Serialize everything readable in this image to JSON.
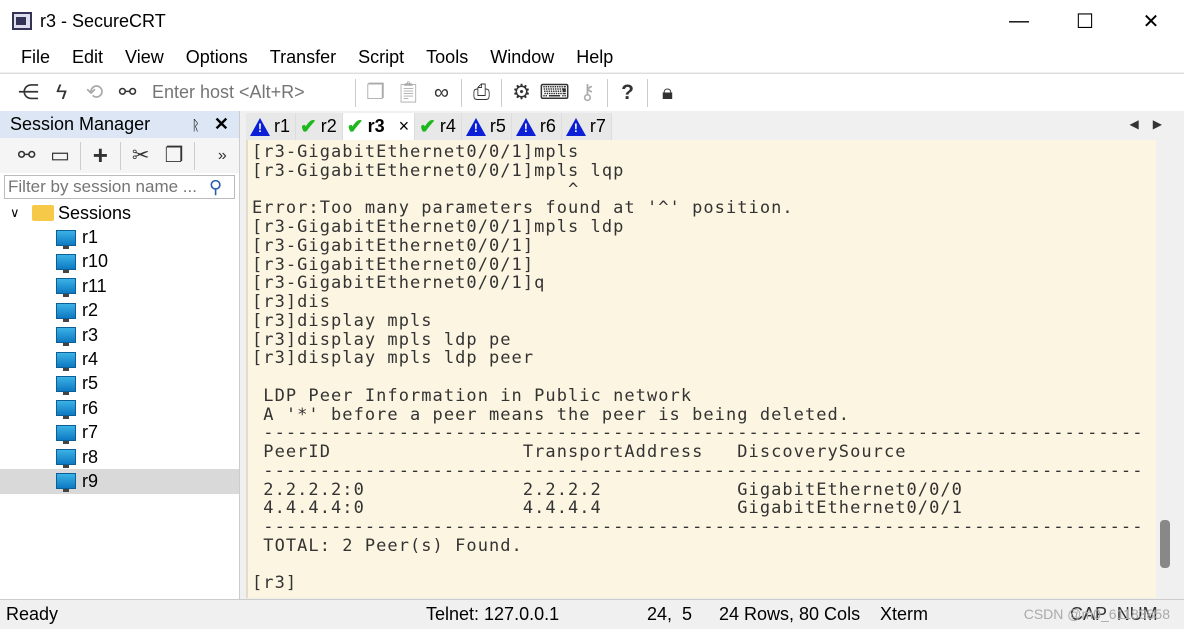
{
  "window": {
    "title": "r3 - SecureCRT",
    "minimize": "—",
    "maximize": "☐",
    "close": "✕"
  },
  "menu": [
    "File",
    "Edit",
    "View",
    "Options",
    "Transfer",
    "Script",
    "Tools",
    "Window",
    "Help"
  ],
  "toolbar": {
    "host_placeholder": "Enter host <Alt+R>",
    "icons": [
      "connect-tree",
      "lightning",
      "reconnect",
      "link",
      "copy",
      "paste",
      "find-binoculars",
      "print",
      "settings-gear",
      "keymap-keyboard",
      "key",
      "help",
      "sftp-lock"
    ]
  },
  "session_manager": {
    "title": "Session Manager",
    "pin": "ᚱ",
    "close": "✕",
    "more": "»",
    "filter_placeholder": "Filter by session name ...",
    "root": "Sessions",
    "sessions": [
      "r1",
      "r10",
      "r11",
      "r2",
      "r3",
      "r4",
      "r5",
      "r6",
      "r7",
      "r8",
      "r9"
    ],
    "selected": "r9"
  },
  "tabs": [
    {
      "label": "r1",
      "status": "warning"
    },
    {
      "label": "r2",
      "status": "connected"
    },
    {
      "label": "r3",
      "status": "connected",
      "active": true
    },
    {
      "label": "r4",
      "status": "connected"
    },
    {
      "label": "r5",
      "status": "warning"
    },
    {
      "label": "r6",
      "status": "warning"
    },
    {
      "label": "r7",
      "status": "warning"
    }
  ],
  "tab_close": "×",
  "tab_nav": "◀▶",
  "terminal": {
    "lines": [
      "[r3-GigabitEthernet0/0/1]mpls",
      "[r3-GigabitEthernet0/0/1]mpls lqp",
      "                            ^",
      "Error:Too many parameters found at '^' position.",
      "[r3-GigabitEthernet0/0/1]mpls ldp",
      "[r3-GigabitEthernet0/0/1]",
      "[r3-GigabitEthernet0/0/1]",
      "[r3-GigabitEthernet0/0/1]q",
      "[r3]dis",
      "[r3]display mpls",
      "[r3]display mpls ldp pe",
      "[r3]display mpls ldp peer",
      "",
      " LDP Peer Information in Public network",
      " A '*' before a peer means the peer is being deleted.",
      " ------------------------------------------------------------------------------",
      " PeerID                 TransportAddress   DiscoverySource",
      " ------------------------------------------------------------------------------",
      " 2.2.2.2:0              2.2.2.2            GigabitEthernet0/0/0",
      " 4.4.4.4:0              4.4.4.4            GigabitEthernet0/0/1",
      " ------------------------------------------------------------------------------",
      " TOTAL: 2 Peer(s) Found.",
      "",
      "[r3]"
    ]
  },
  "status": {
    "ready": "Ready",
    "connection": "Telnet: 127.0.0.1",
    "cursor": "24,  5",
    "size": "24 Rows, 80 Cols",
    "emulation": "Xterm",
    "keys": "CAP  NUM",
    "watermark": "CSDN @m0_61183858"
  },
  "colors": {
    "terminal_bg": "#fcf5e1",
    "warning": "#0a1fd6",
    "connected": "#1cb81c"
  }
}
